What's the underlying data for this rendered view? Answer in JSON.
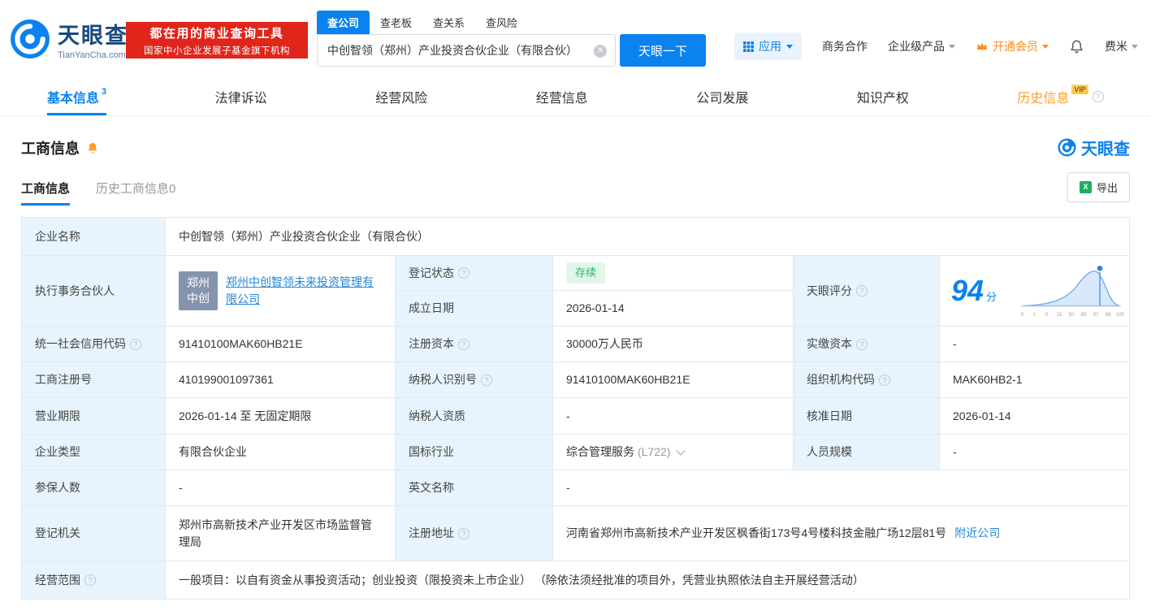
{
  "header": {
    "brand": {
      "name": "天眼查",
      "domain": "TianYanCha.com"
    },
    "promo": {
      "line1": "都在用的商业查询工具",
      "line2": "国家中小企业发展子基金旗下机构"
    },
    "search": {
      "tabs": [
        "查公司",
        "查老板",
        "查关系",
        "查风险"
      ],
      "query": "中创智领（郑州）产业投资合伙企业（有限合伙）",
      "submit": "天眼一下"
    },
    "menu": {
      "apps": "应用",
      "cooperation": "商务合作",
      "enterprise": "企业级产品",
      "vip": "开通会员",
      "user": "费米"
    }
  },
  "nav_tabs": [
    {
      "label": "基本信息",
      "count": "3"
    },
    {
      "label": "法律诉讼"
    },
    {
      "label": "经营风险"
    },
    {
      "label": "经营信息"
    },
    {
      "label": "公司发展"
    },
    {
      "label": "知识产权"
    },
    {
      "label": "历史信息",
      "vip": "VIP"
    }
  ],
  "section": {
    "title": "工商信息",
    "logo": "天眼查",
    "subtabs": [
      {
        "label": "工商信息"
      },
      {
        "label": "历史工商信息0"
      }
    ],
    "export": "导出"
  },
  "table": {
    "company_name_label": "企业名称",
    "company_name": "中创智领（郑州）产业投资合伙企业（有限合伙）",
    "partner_label": "执行事务合伙人",
    "partner_avatar": "郑州中创",
    "partner_name": "郑州中创智领未来投资管理有限公司",
    "status_label": "登记状态",
    "status": "存续",
    "established_label": "成立日期",
    "established": "2026-01-14",
    "score_label": "天眼评分",
    "score": "94",
    "score_unit": "分",
    "credit_code_label": "统一社会信用代码",
    "credit_code": "91410100MAK60HB21E",
    "reg_capital_label": "注册资本",
    "reg_capital": "30000万人民币",
    "paid_capital_label": "实缴资本",
    "paid_capital": "-",
    "reg_number_label": "工商注册号",
    "reg_number": "410199001097361",
    "taxpayer_id_label": "纳税人识别号",
    "taxpayer_id": "91410100MAK60HB21E",
    "org_code_label": "组织机构代码",
    "org_code": "MAK60HB2-1",
    "business_term_label": "营业期限",
    "business_term": "2026-01-14 至 无固定期限",
    "taxpayer_quality_label": "纳税人资质",
    "taxpayer_quality": "-",
    "approval_date_label": "核准日期",
    "approval_date": "2026-01-14",
    "company_type_label": "企业类型",
    "company_type": "有限合伙企业",
    "industry_label": "国标行业",
    "industry": "综合管理服务",
    "industry_code": "(L722)",
    "staff_size_label": "人员规模",
    "staff_size": "-",
    "insured_label": "参保人数",
    "insured": "-",
    "english_name_label": "英文名称",
    "english_name": "-",
    "registry_label": "登记机关",
    "registry": "郑州市高新技术产业开发区市场监督管理局",
    "address_label": "注册地址",
    "address": "河南省郑州市高新技术产业开发区枫香街173号4号楼科技金融广场12层81号",
    "nearby_link": "附近公司",
    "scope_label": "经营范围",
    "scope": "一般项目：以自有资金从事投资活动；创业投资（限投资未上市企业） （除依法须经批准的项目外，凭营业执照依法自主开展经营活动）"
  },
  "score_chart": {
    "type": "area",
    "score": 94,
    "ticks": [
      "0",
      "1",
      "5",
      "15",
      "50",
      "85",
      "97",
      "99",
      "100"
    ]
  }
}
